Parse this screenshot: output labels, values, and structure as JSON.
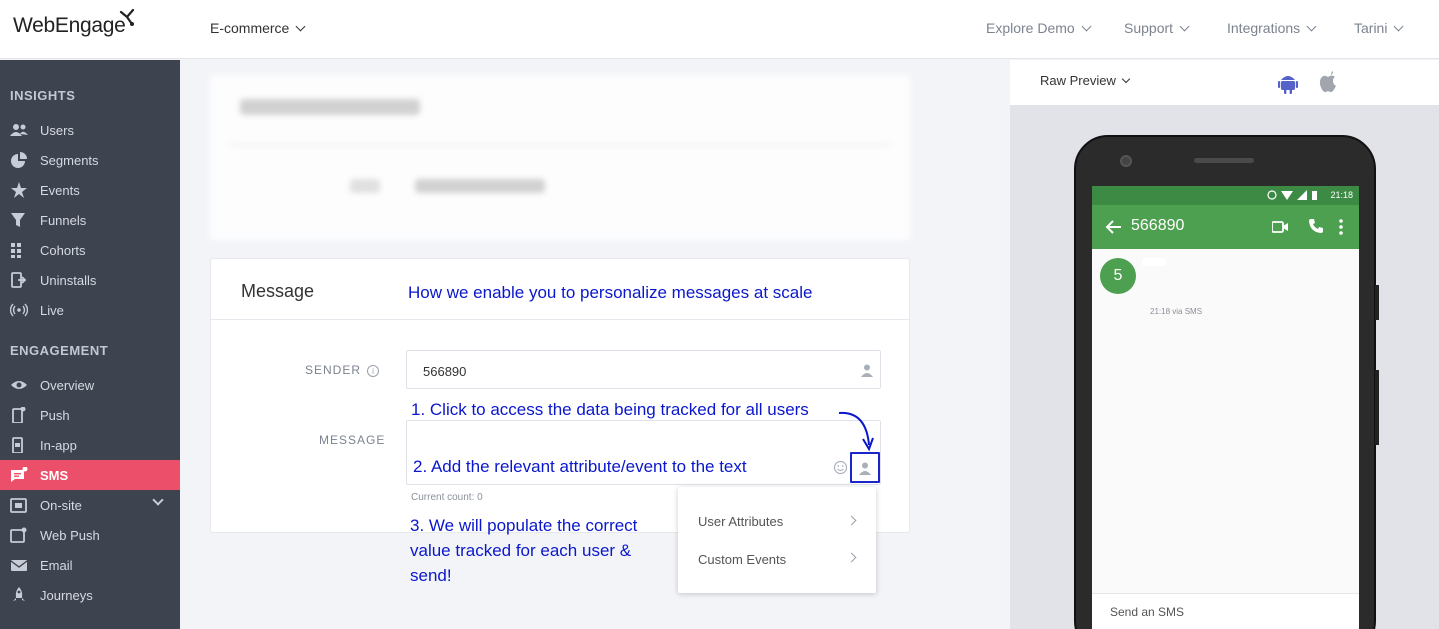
{
  "header": {
    "logo_text": "WebEngage",
    "project": "E-commerce",
    "nav": [
      "Explore Demo",
      "Support",
      "Integrations",
      "Tarini"
    ]
  },
  "sidebar": {
    "insights_title": "INSIGHTS",
    "insights": [
      {
        "label": "Users",
        "icon": "users-icon"
      },
      {
        "label": "Segments",
        "icon": "pie-icon"
      },
      {
        "label": "Events",
        "icon": "star-icon"
      },
      {
        "label": "Funnels",
        "icon": "funnel-icon"
      },
      {
        "label": "Cohorts",
        "icon": "grid-icon"
      },
      {
        "label": "Uninstalls",
        "icon": "uninstall-icon"
      },
      {
        "label": "Live",
        "icon": "broadcast-icon"
      }
    ],
    "engagement_title": "ENGAGEMENT",
    "engagement": [
      {
        "label": "Overview",
        "icon": "eye-icon"
      },
      {
        "label": "Push",
        "icon": "push-icon"
      },
      {
        "label": "In-app",
        "icon": "inapp-icon"
      },
      {
        "label": "SMS",
        "icon": "sms-icon",
        "active": true
      },
      {
        "label": "On-site",
        "icon": "onsite-icon",
        "expandable": true
      },
      {
        "label": "Web Push",
        "icon": "webpush-icon"
      },
      {
        "label": "Email",
        "icon": "email-icon"
      },
      {
        "label": "Journeys",
        "icon": "rocket-icon"
      }
    ],
    "active_color": "#ec4f69"
  },
  "message": {
    "title": "Message",
    "sender_label": "SENDER",
    "sender_value": "566890",
    "message_label": "MESSAGE",
    "current_count": "Current count: 0"
  },
  "annotations": {
    "headline": "How we enable you to personalize messages at scale",
    "step1": "1. Click to access the data being tracked for all users",
    "step2": "2. Add the relevant attribute/event to the text",
    "step3": [
      "3. We will populate the correct",
      "value tracked for each user &",
      "send!"
    ],
    "color": "#0a17cc"
  },
  "dropdown": {
    "items": [
      "User Attributes",
      "Custom Events"
    ]
  },
  "preview": {
    "title": "Raw Preview",
    "status_time": "21:18",
    "contact": "566890",
    "avatar": "5",
    "via": "21:18 via SMS",
    "compose_placeholder": "Send an SMS",
    "app_color": "#4da04f"
  }
}
